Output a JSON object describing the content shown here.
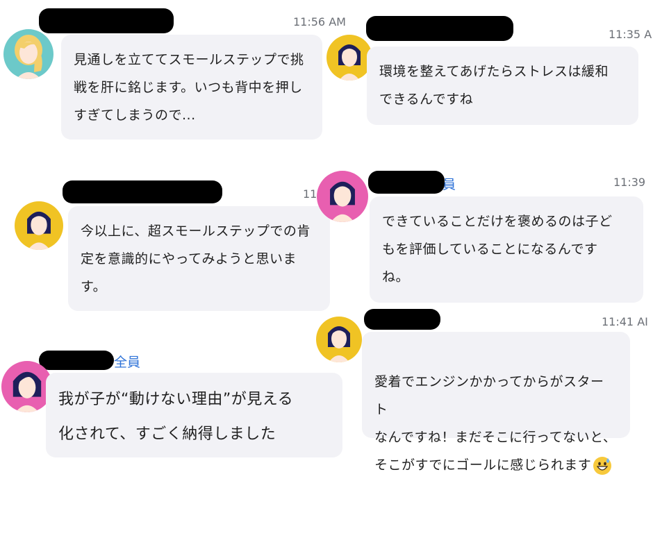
{
  "messages": [
    {
      "time": "11:56 AM",
      "text": "見通しを立ててスモールステップで挑\n戦を肝に銘じます。いつも背中を押し\nすぎてしまうので..."
    },
    {
      "time": "11:35 A",
      "text": "環境を整えてあげたらストレスは緩和\nできるんですね"
    },
    {
      "time": "11",
      "text": "今以上に、超スモールステップでの肯\n定を意識的にやってみようと思いま\nす。"
    },
    {
      "time": "11:39",
      "to_suffix": "員",
      "text": "できていることだけを褒めるのは子ど\nもを評価していることになるんです\nね。"
    },
    {
      "time": "11:41 AI",
      "text": "愛着でエンジンかかってからがスタート\nなんですね！まだそこに行ってないと、\nそこがすでにゴールに感じられます"
    },
    {
      "to": "全員",
      "text": "我が子が“動けない理由”が見える\n化されて、すごく納得しました"
    }
  ],
  "avatars": {
    "blonde": {
      "bg": "#6cc9c9",
      "hair": "#f3cf6b",
      "skin": "#fde6d8"
    },
    "yellow": {
      "bg": "#f0c324",
      "hair": "#1e1f5a",
      "skin": "#fde6d8"
    },
    "pink": {
      "bg": "#e85fb0",
      "hair": "#1e1f5a",
      "skin": "#fde6d8"
    }
  },
  "emoji_name": "grinning-face-with-sweat-icon"
}
